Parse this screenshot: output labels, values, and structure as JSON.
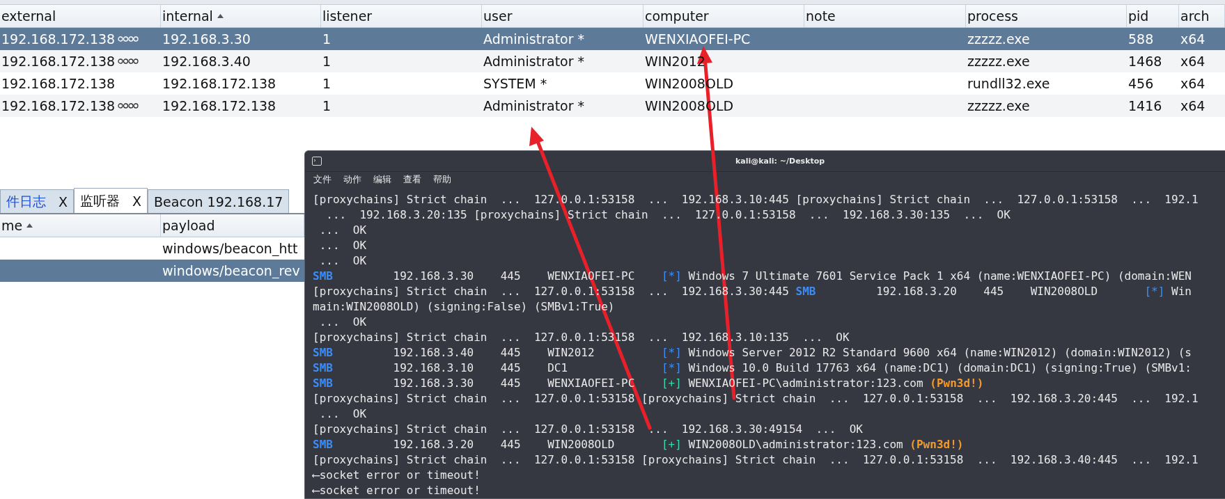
{
  "sessions_table": {
    "columns": [
      {
        "label": "external",
        "sorted": false
      },
      {
        "label": "internal",
        "sorted": true
      },
      {
        "label": "listener",
        "sorted": false
      },
      {
        "label": "user",
        "sorted": false
      },
      {
        "label": "computer",
        "sorted": false
      },
      {
        "label": "note",
        "sorted": false
      },
      {
        "label": "process",
        "sorted": false
      },
      {
        "label": "pid",
        "sorted": false
      },
      {
        "label": "arch",
        "sorted": false
      }
    ],
    "rows": [
      {
        "selected": true,
        "linked": true,
        "external": "192.168.172.138",
        "internal": "192.168.3.30",
        "listener": "1",
        "user": "Administrator *",
        "computer": "WENXIAOFEI-PC",
        "process": "zzzzz.exe",
        "pid": "588",
        "arch": "x64"
      },
      {
        "selected": false,
        "linked": true,
        "external": "192.168.172.138",
        "internal": "192.168.3.40",
        "listener": "1",
        "user": "Administrator *",
        "computer": "WIN2012",
        "process": "zzzzz.exe",
        "pid": "1468",
        "arch": "x64"
      },
      {
        "selected": false,
        "linked": false,
        "external": "192.168.172.138",
        "internal": "192.168.172.138",
        "listener": "1",
        "user": "SYSTEM *",
        "computer": "WIN2008OLD",
        "process": "rundll32.exe",
        "pid": "456",
        "arch": "x64"
      },
      {
        "selected": false,
        "linked": true,
        "external": "192.168.172.138",
        "internal": "192.168.172.138",
        "listener": "1",
        "user": "Administrator *",
        "computer": "WIN2008OLD",
        "process": "zzzzz.exe",
        "pid": "1416",
        "arch": "x64"
      }
    ]
  },
  "tabs": [
    {
      "label": "件日志",
      "close": "X",
      "selected": false,
      "highlighted": true
    },
    {
      "label": "监听器",
      "close": "X",
      "selected": true,
      "highlighted": false
    },
    {
      "label": "Beacon 192.168.17",
      "selected": false,
      "highlighted": false
    }
  ],
  "listeners_table": {
    "columns": [
      {
        "label": "me",
        "sorted": true
      },
      {
        "label": "payload",
        "sorted": false
      }
    ],
    "rows": [
      {
        "selected": false,
        "payload": "windows/beacon_htt"
      },
      {
        "selected": true,
        "payload": "windows/beacon_rev"
      }
    ]
  },
  "terminal": {
    "title": "kali@kali: ~/Desktop",
    "menu": [
      "文件",
      "动作",
      "编辑",
      "查看",
      "帮助"
    ],
    "lines": [
      [
        {
          "kind": "plain",
          "text": "[proxychains] Strict chain  ...  127.0.0.1:53158  ...  192.168.3.10:445 [proxychains] Strict chain  ...  127.0.0.1:53158  ...  192.1"
        }
      ],
      [
        {
          "kind": "plain",
          "text": "  ...  192.168.3.20:135 [proxychains] Strict chain  ...  127.0.0.1:53158  ...  192.168.3.30:135  ...  OK"
        }
      ],
      [
        {
          "kind": "plain",
          "text": " ...  OK"
        }
      ],
      [
        {
          "kind": "plain",
          "text": " ...  OK"
        }
      ],
      [
        {
          "kind": "plain",
          "text": " ...  OK"
        }
      ],
      [
        {
          "kind": "smb",
          "text": "SMB"
        },
        {
          "kind": "plain",
          "text": "         192.168.3.30    445    WENXIAOFEI-PC    "
        },
        {
          "kind": "info",
          "text": "[*]"
        },
        {
          "kind": "plain",
          "text": " Windows 7 Ultimate 7601 Service Pack 1 x64 (name:WENXIAOFEI-PC) (domain:WEN"
        }
      ],
      [
        {
          "kind": "plain",
          "text": "[proxychains] Strict chain  ...  127.0.0.1:53158  ...  192.168.3.30:445 "
        },
        {
          "kind": "smb",
          "text": "SMB"
        },
        {
          "kind": "plain",
          "text": "         192.168.3.20    445    WIN2008OLD       "
        },
        {
          "kind": "info",
          "text": "[*]"
        },
        {
          "kind": "plain",
          "text": " Win"
        }
      ],
      [
        {
          "kind": "plain",
          "text": "main:WIN2008OLD) (signing:False) (SMBv1:True)"
        }
      ],
      [
        {
          "kind": "plain",
          "text": " ...  OK"
        }
      ],
      [
        {
          "kind": "plain",
          "text": "[proxychains] Strict chain  ...  127.0.0.1:53158  ...  192.168.3.10:135  ...  OK"
        }
      ],
      [
        {
          "kind": "smb",
          "text": "SMB"
        },
        {
          "kind": "plain",
          "text": "         192.168.3.40    445    WIN2012          "
        },
        {
          "kind": "info",
          "text": "[*]"
        },
        {
          "kind": "plain",
          "text": " Windows Server 2012 R2 Standard 9600 x64 (name:WIN2012) (domain:WIN2012) (s"
        }
      ],
      [
        {
          "kind": "smb",
          "text": "SMB"
        },
        {
          "kind": "plain",
          "text": "         192.168.3.10    445    DC1              "
        },
        {
          "kind": "info",
          "text": "[*]"
        },
        {
          "kind": "plain",
          "text": " Windows 10.0 Build 17763 x64 (name:DC1) (domain:DC1) (signing:True) (SMBv1:"
        }
      ],
      [
        {
          "kind": "smb",
          "text": "SMB"
        },
        {
          "kind": "plain",
          "text": "         192.168.3.30    445    WENXIAOFEI-PC    "
        },
        {
          "kind": "success",
          "text": "[+]"
        },
        {
          "kind": "plain",
          "text": " WENXIAOFEI-PC\\administrator:123.com "
        },
        {
          "kind": "pwned",
          "text": "(Pwn3d!)"
        }
      ],
      [
        {
          "kind": "plain",
          "text": "[proxychains] Strict chain  ...  127.0.0.1:53158 [proxychains] Strict chain  ...  127.0.0.1:53158  ...  192.168.3.20:445  ...  192.1"
        }
      ],
      [
        {
          "kind": "plain",
          "text": " ...  OK"
        }
      ],
      [
        {
          "kind": "plain",
          "text": "[proxychains] Strict chain  ...  127.0.0.1:53158  ...  192.168.3.30:49154  ...  OK"
        }
      ],
      [
        {
          "kind": "smb",
          "text": "SMB"
        },
        {
          "kind": "plain",
          "text": "         192.168.3.20    445    WIN2008OLD       "
        },
        {
          "kind": "success",
          "text": "[+]"
        },
        {
          "kind": "plain",
          "text": " WIN2008OLD\\administrator:123.com "
        },
        {
          "kind": "pwned",
          "text": "(Pwn3d!)"
        }
      ],
      [
        {
          "kind": "plain",
          "text": "[proxychains] Strict chain  ...  127.0.0.1:53158 [proxychains] Strict chain  ...  127.0.0.1:53158  ...  192.168.3.40:445  ...  192.1"
        }
      ],
      [
        {
          "kind": "plain",
          "text": "⟵socket error or timeout!"
        }
      ],
      [
        {
          "kind": "plain",
          "text": "⟵socket error or timeout!"
        }
      ]
    ]
  }
}
